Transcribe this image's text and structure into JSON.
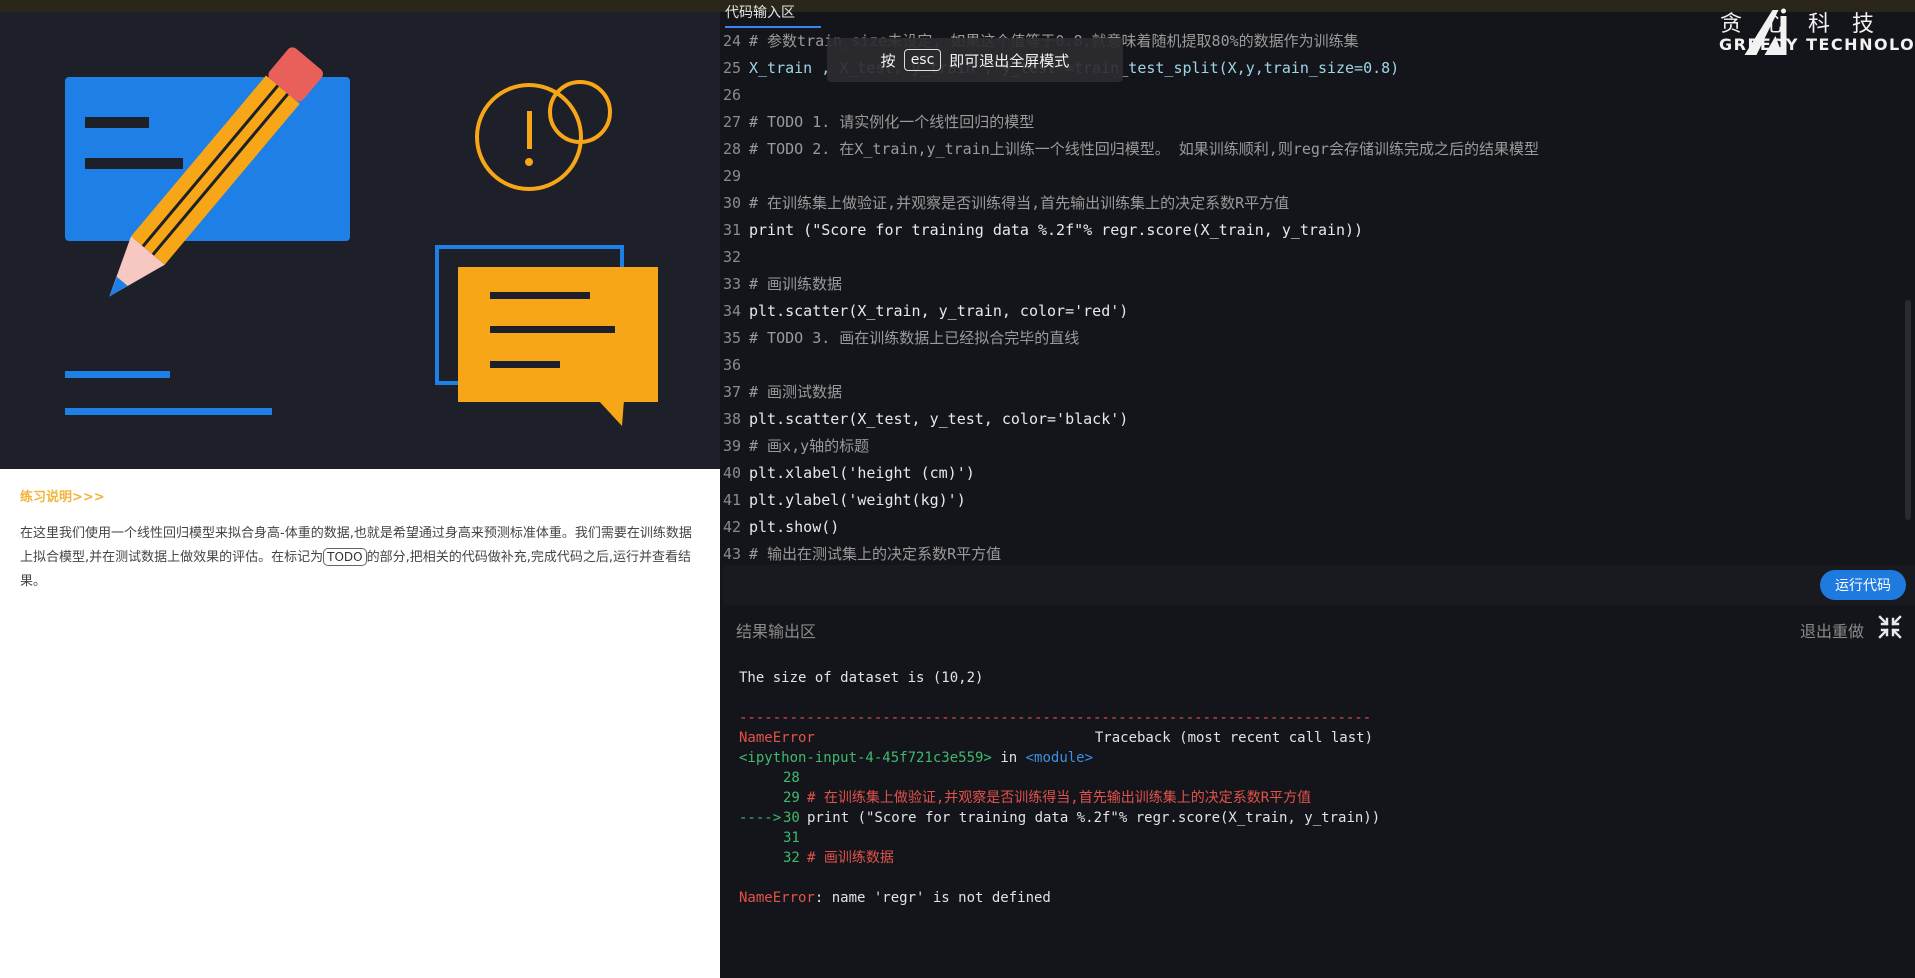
{
  "illustration": {
    "name": "exercise-illustration"
  },
  "left_panel": {
    "title": "练习说明>>>",
    "desc_part1": "在这里我们使用一个线性回归模型来拟合身高-体重的数据,也就是希望通过身高来预测标准体重。我们需要在训练数据上拟合模型,并在测试数据上做效果的评估。在标记为",
    "todo_tag": "TODO",
    "desc_part2": "的部分,把相关的代码做补充,完成代码之后,运行并查看结果。"
  },
  "editor": {
    "tab_label": "代码输入区",
    "lines": [
      {
        "n": "24",
        "code": "# 参数train_size未设定, 如果这个值等于0.8,就意味着随机提取80%的数据作为训练集"
      },
      {
        "n": "25",
        "code": "X_train , X_test, y_train , y_test =train_test_split(X,y,train_size=0.8)"
      },
      {
        "n": "26",
        "code": ""
      },
      {
        "n": "27",
        "code": "# TODO 1. 请实例化一个线性回归的模型"
      },
      {
        "n": "28",
        "code": "# TODO 2. 在X_train,y_train上训练一个线性回归模型。 如果训练顺利,则regr会存储训练完成之后的结果模型"
      },
      {
        "n": "29",
        "code": ""
      },
      {
        "n": "30",
        "code": "# 在训练集上做验证,并观察是否训练得当,首先输出训练集上的决定系数R平方值"
      },
      {
        "n": "31",
        "code": "print (\"Score for training data %.2f\"% regr.score(X_train, y_train))"
      },
      {
        "n": "32",
        "code": ""
      },
      {
        "n": "33",
        "code": "# 画训练数据"
      },
      {
        "n": "34",
        "code": "plt.scatter(X_train, y_train, color='red')"
      },
      {
        "n": "35",
        "code": "# TODO 3. 画在训练数据上已经拟合完毕的直线"
      },
      {
        "n": "36",
        "code": ""
      },
      {
        "n": "37",
        "code": "# 画测试数据"
      },
      {
        "n": "38",
        "code": "plt.scatter(X_test, y_test, color='black')"
      },
      {
        "n": "39",
        "code": "# 画x,y轴的标题"
      },
      {
        "n": "40",
        "code": "plt.xlabel('height (cm)')"
      },
      {
        "n": "41",
        "code": "plt.ylabel('weight(kg)')"
      },
      {
        "n": "42",
        "code": "plt.show()"
      },
      {
        "n": "43",
        "code": "# 输出在测试集上的决定系数R平方值"
      }
    ]
  },
  "toast": {
    "prefix": "按",
    "key": "esc",
    "suffix": "即可退出全屏模式"
  },
  "logo": {
    "cn": "贪心科技",
    "en": "GREEDY TECHNOLOGY"
  },
  "run_button": "运行代码",
  "output": {
    "header": "结果输出区",
    "reset": "退出重做",
    "dataset_line": "The size of dataset is (10,2)",
    "separator": "---------------------------------------------------------------------------",
    "error_name": "NameError",
    "traceback_label": "Traceback (most recent call last)",
    "input_ref": "<ipython-input-4-45f721c3e559>",
    "in_text": "in",
    "module": "<module>",
    "tb_lines": [
      {
        "arrow": "",
        "n": "28",
        "code": ""
      },
      {
        "arrow": "",
        "n": "29",
        "code": "# 在训练集上做验证,并观察是否训练得当,首先输出训练集上的决定系数R平方值"
      },
      {
        "arrow": "---->",
        "n": "30",
        "code": "print (\"Score for training data %.2f\"% regr.score(X_train, y_train))"
      },
      {
        "arrow": "",
        "n": "31",
        "code": ""
      },
      {
        "arrow": "",
        "n": "32",
        "code": "# 画训练数据"
      }
    ],
    "error_message": ": name 'regr' is not defined"
  }
}
